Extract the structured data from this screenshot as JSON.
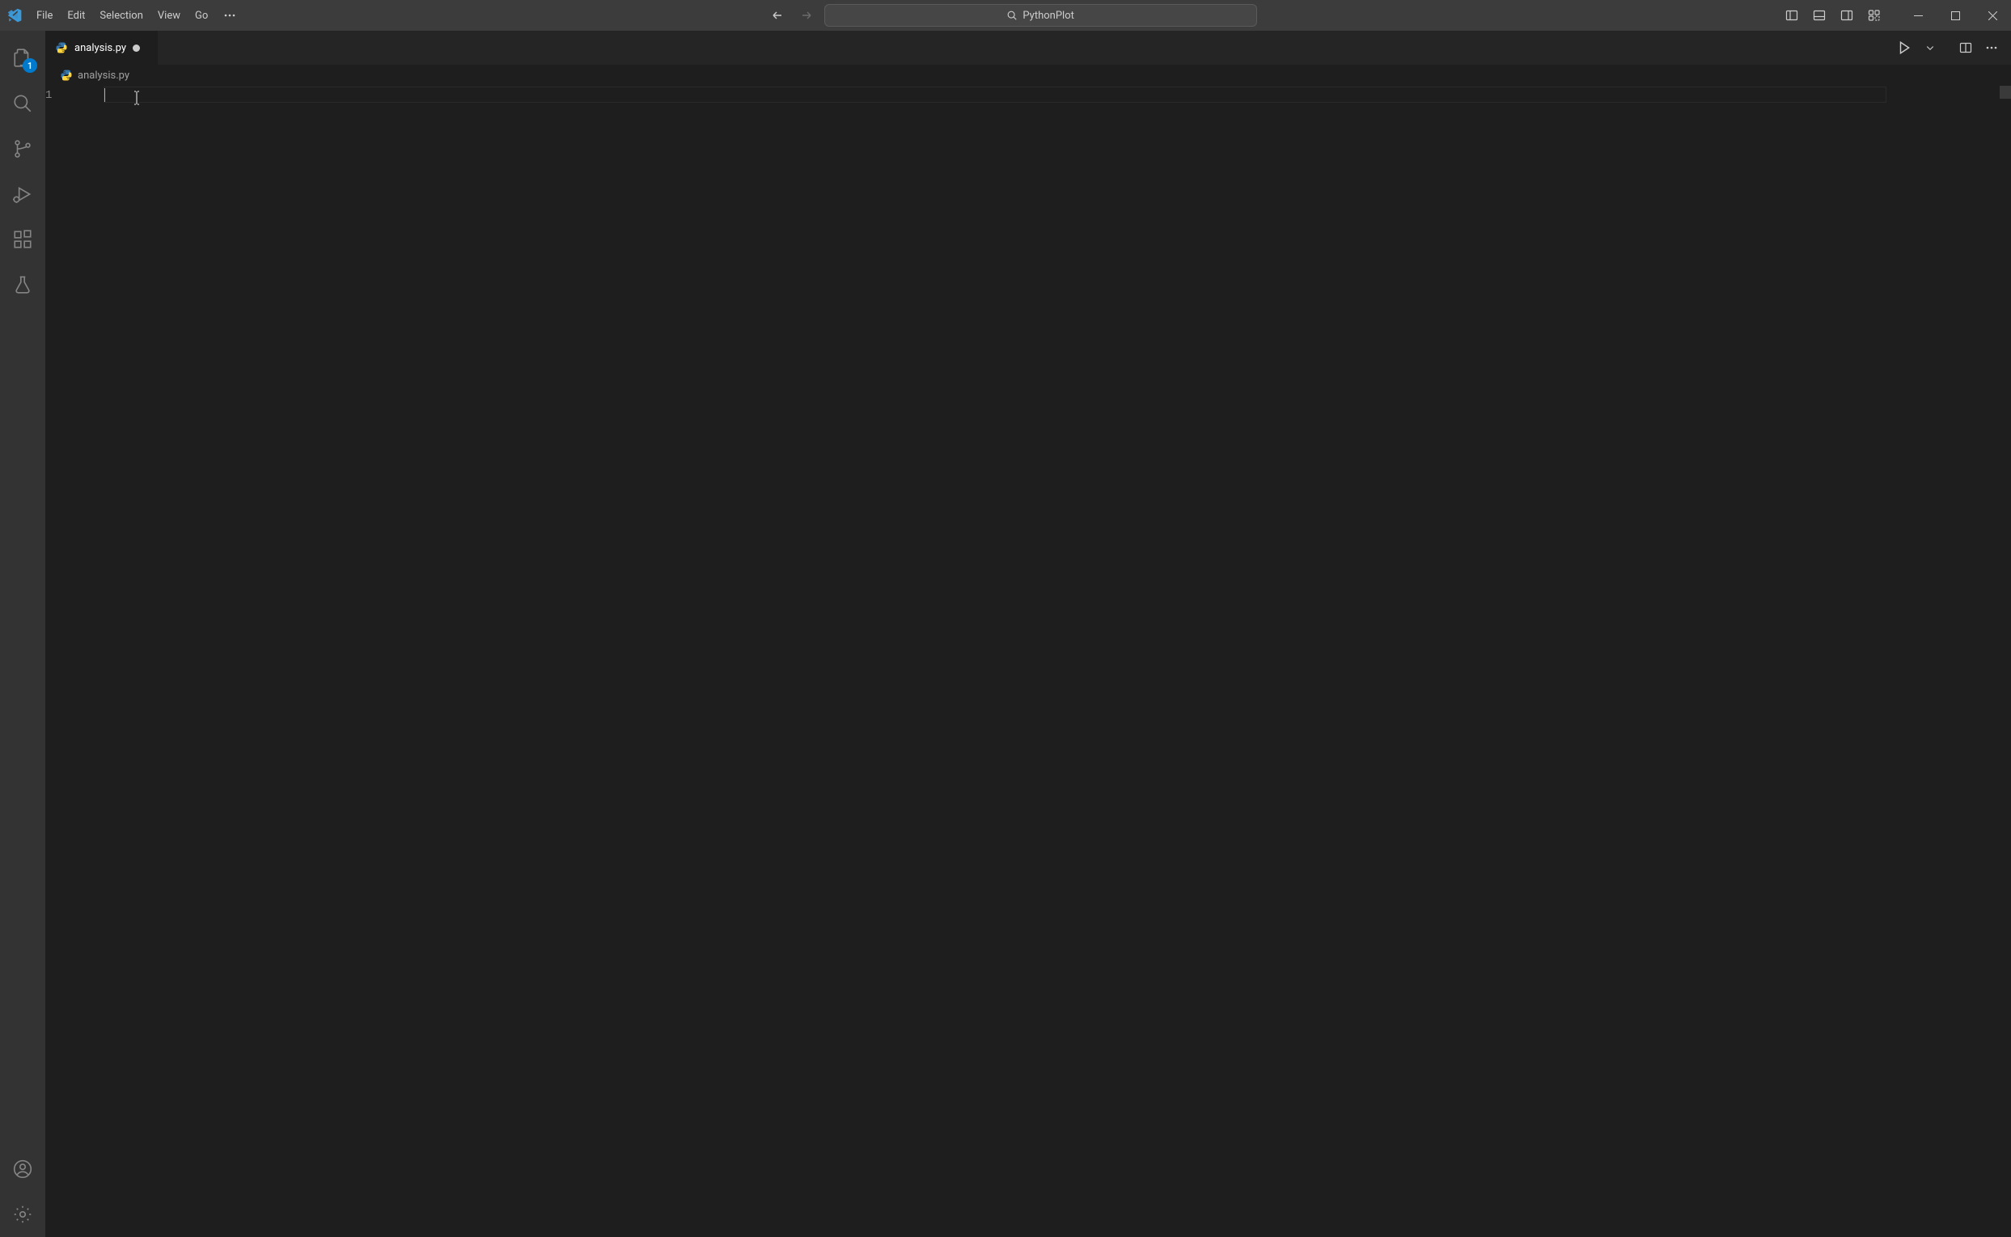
{
  "menu": {
    "file": "File",
    "edit": "Edit",
    "selection": "Selection",
    "view": "View",
    "go": "Go"
  },
  "search_text": "PythonPlot",
  "tabs": [
    {
      "label": "analysis.py",
      "dirty": true,
      "icon": "python"
    }
  ],
  "breadcrumb": {
    "filename": "analysis.py",
    "icon": "python"
  },
  "editor": {
    "line_numbers": [
      "1"
    ],
    "lines": [
      ""
    ]
  },
  "activity": {
    "explorer_badge": "1"
  }
}
